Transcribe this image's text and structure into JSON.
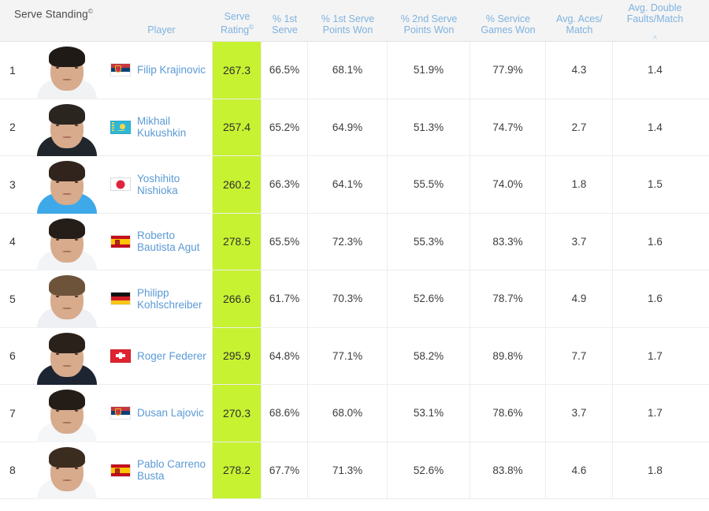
{
  "title": {
    "text": "Serve Standing",
    "mark": "©"
  },
  "columns": [
    {
      "key": "rank",
      "label": "",
      "sort": ""
    },
    {
      "key": "photo",
      "label": "",
      "sort": ""
    },
    {
      "key": "player",
      "label": "Player",
      "sort": ""
    },
    {
      "key": "rating",
      "label": "Serve\nRating",
      "mark": "©",
      "sort": ""
    },
    {
      "key": "pct1st",
      "label": "% 1st\nServe",
      "sort": ""
    },
    {
      "key": "pts1st",
      "label": "% 1st Serve\nPoints Won",
      "sort": ""
    },
    {
      "key": "pts2nd",
      "label": "% 2nd Serve\nPoints Won",
      "sort": ""
    },
    {
      "key": "svcgames",
      "label": "% Service\nGames Won",
      "sort": ""
    },
    {
      "key": "aces",
      "label": "Avg. Aces/\nMatch",
      "sort": ""
    },
    {
      "key": "dfaults",
      "label": "Avg. Double\nFaults/Match",
      "sort": "asc",
      "sort_icon": "chevron-up"
    }
  ],
  "colors": {
    "accent_green": "#c7f231",
    "link_blue": "#5b9ad5",
    "header_blue": "#7eb2e0",
    "header_bg": "#f4f4f4",
    "grid": "#ededed",
    "text": "#3c3c3c"
  },
  "rows": [
    {
      "rank": "1",
      "player": "Filip Krajinovic",
      "country": "srb",
      "rating": "267.3",
      "pct1st": "66.5%",
      "pts1st": "68.1%",
      "pts2nd": "51.9%",
      "svcgames": "77.9%",
      "aces": "4.3",
      "dfaults": "1.4"
    },
    {
      "rank": "2",
      "player": "Mikhail\nKukushkin",
      "country": "kaz",
      "rating": "257.4",
      "pct1st": "65.2%",
      "pts1st": "64.9%",
      "pts2nd": "51.3%",
      "svcgames": "74.7%",
      "aces": "2.7",
      "dfaults": "1.4"
    },
    {
      "rank": "3",
      "player": "Yoshihito\nNishioka",
      "country": "jpn",
      "rating": "260.2",
      "pct1st": "66.3%",
      "pts1st": "64.1%",
      "pts2nd": "55.5%",
      "svcgames": "74.0%",
      "aces": "1.8",
      "dfaults": "1.5"
    },
    {
      "rank": "4",
      "player": "Roberto\nBautista Agut",
      "country": "esp",
      "rating": "278.5",
      "pct1st": "65.5%",
      "pts1st": "72.3%",
      "pts2nd": "55.3%",
      "svcgames": "83.3%",
      "aces": "3.7",
      "dfaults": "1.6"
    },
    {
      "rank": "5",
      "player": "Philipp\nKohlschreiber",
      "country": "ger",
      "rating": "266.6",
      "pct1st": "61.7%",
      "pts1st": "70.3%",
      "pts2nd": "52.6%",
      "svcgames": "78.7%",
      "aces": "4.9",
      "dfaults": "1.6"
    },
    {
      "rank": "6",
      "player": "Roger Federer",
      "country": "sui",
      "rating": "295.9",
      "pct1st": "64.8%",
      "pts1st": "77.1%",
      "pts2nd": "58.2%",
      "svcgames": "89.8%",
      "aces": "7.7",
      "dfaults": "1.7"
    },
    {
      "rank": "7",
      "player": "Dusan Lajovic",
      "country": "srb",
      "rating": "270.3",
      "pct1st": "68.6%",
      "pts1st": "68.0%",
      "pts2nd": "53.1%",
      "svcgames": "78.6%",
      "aces": "3.7",
      "dfaults": "1.7"
    },
    {
      "rank": "8",
      "player": "Pablo Carreno\nBusta",
      "country": "esp",
      "rating": "278.2",
      "pct1st": "67.7%",
      "pts1st": "71.3%",
      "pts2nd": "52.6%",
      "svcgames": "83.8%",
      "aces": "4.6",
      "dfaults": "1.8"
    }
  ]
}
